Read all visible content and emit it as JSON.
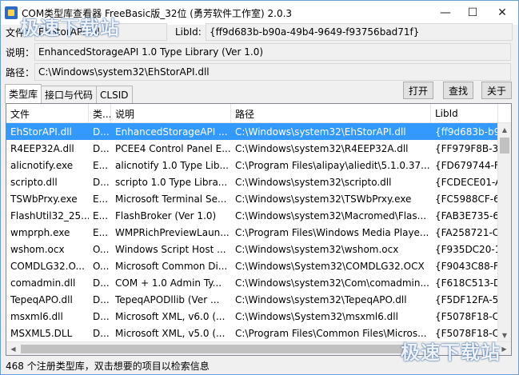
{
  "window": {
    "title": "COM类型库查看器 FreeBasic版_32位 (勇芳软件工作室) 2.0.3",
    "minimize": "—",
    "maximize": "☐",
    "close": "✕"
  },
  "watermark": {
    "top_left": "极速下载站",
    "bottom_right": "极速下载站"
  },
  "fields": {
    "file_label": "文件：",
    "file_value": "EhStorAPI.dll",
    "libid_label": "LibId:",
    "libid_value": "{ff9d683b-b90a-49b4-9649-f93756bad71f}",
    "desc_label": "说明：",
    "desc_value": "EnhancedStorageAPI 1.0 Type Library (Ver 1.0)",
    "path_label": "路径：",
    "path_value": "C:\\Windows\\system32\\EhStorAPI.dll"
  },
  "tabs": [
    {
      "label": "类型库"
    },
    {
      "label": "接口与代码"
    },
    {
      "label": "CLSID"
    }
  ],
  "buttons": {
    "open": "打开",
    "find": "查找",
    "about": "关于"
  },
  "table": {
    "headers": [
      "文件",
      "类...",
      "说明",
      "路径",
      "LibId"
    ],
    "rows": [
      [
        "EhStorAPI.dll",
        "D...",
        "EnhancedStorageAPI ...",
        "C:\\Windows\\system32\\EhStorAPI.dll",
        "{ff9d683b-b9..."
      ],
      [
        "R4EEP32A.dll",
        "D...",
        "PCEE4 Control Panel E...",
        "C:\\Windows\\system32\\R4EEP32A.dll",
        "{FF979F8B-35..."
      ],
      [
        "alicnotify.exe",
        "E...",
        "alicnotify 1.0 Type Lib...",
        "C:\\Program Files\\alipay\\aliedit\\5.1.0.37...",
        "{FD679744-FF..."
      ],
      [
        "scripto.dll",
        "D...",
        "scripto 1.0 Type Libra...",
        "C:\\Windows\\system32\\scripto.dll",
        "{FCDECE01-A..."
      ],
      [
        "TSWbPrxy.exe",
        "E...",
        "Microsoft Terminal Se...",
        "C:\\Windows\\system32\\TSWbPrxy.exe",
        "{FC5988CF-6..."
      ],
      [
        "FlashUtil32_25...",
        "E...",
        "FlashBroker (Ver 1.0)",
        "C:\\Windows\\system32\\Macromed\\Flas...",
        "{FAB3E735-6..."
      ],
      [
        "wmprph.exe",
        "E...",
        "WMPRichPreviewLaun...",
        "C:\\Program Files\\Windows Media Playe...",
        "{FA258721-CF..."
      ],
      [
        "wshom.ocx",
        "O...",
        "Windows Script Host ...",
        "C:\\Windows\\system32\\wshom.ocx",
        "{F935DC20-1..."
      ],
      [
        "COMDLG32.O...",
        "O...",
        "Microsoft Common Di...",
        "C:\\Windows\\System32\\COMDLG32.OCX",
        "{F9043C88-F6..."
      ],
      [
        "comadmin.dll",
        "D...",
        "COM + 1.0 Admin Ty...",
        "C:\\Windows\\system32\\Com\\comadmin...",
        "{F618C513-D..."
      ],
      [
        "TepeqAPO.dll",
        "D...",
        "TepeqAPODllib (Ver ...",
        "C:\\Windows\\system32\\TepeqAPO.dll",
        "{F5DF12FA-5E..."
      ],
      [
        "msxml6.dll",
        "D...",
        "Microsoft XML, v6.0 (...",
        "C:\\Windows\\System32\\msxml6.dll",
        "{F5078F18-C5..."
      ],
      [
        "MSXML5.DLL",
        "D...",
        "Microsoft XML, v5.0 (...",
        "C:\\Program Files\\Common Files\\Micros...",
        "{F5078F18-C5..."
      ]
    ]
  },
  "status": {
    "text": "468 个注册类型库，双击想要的项目以检索信息"
  }
}
